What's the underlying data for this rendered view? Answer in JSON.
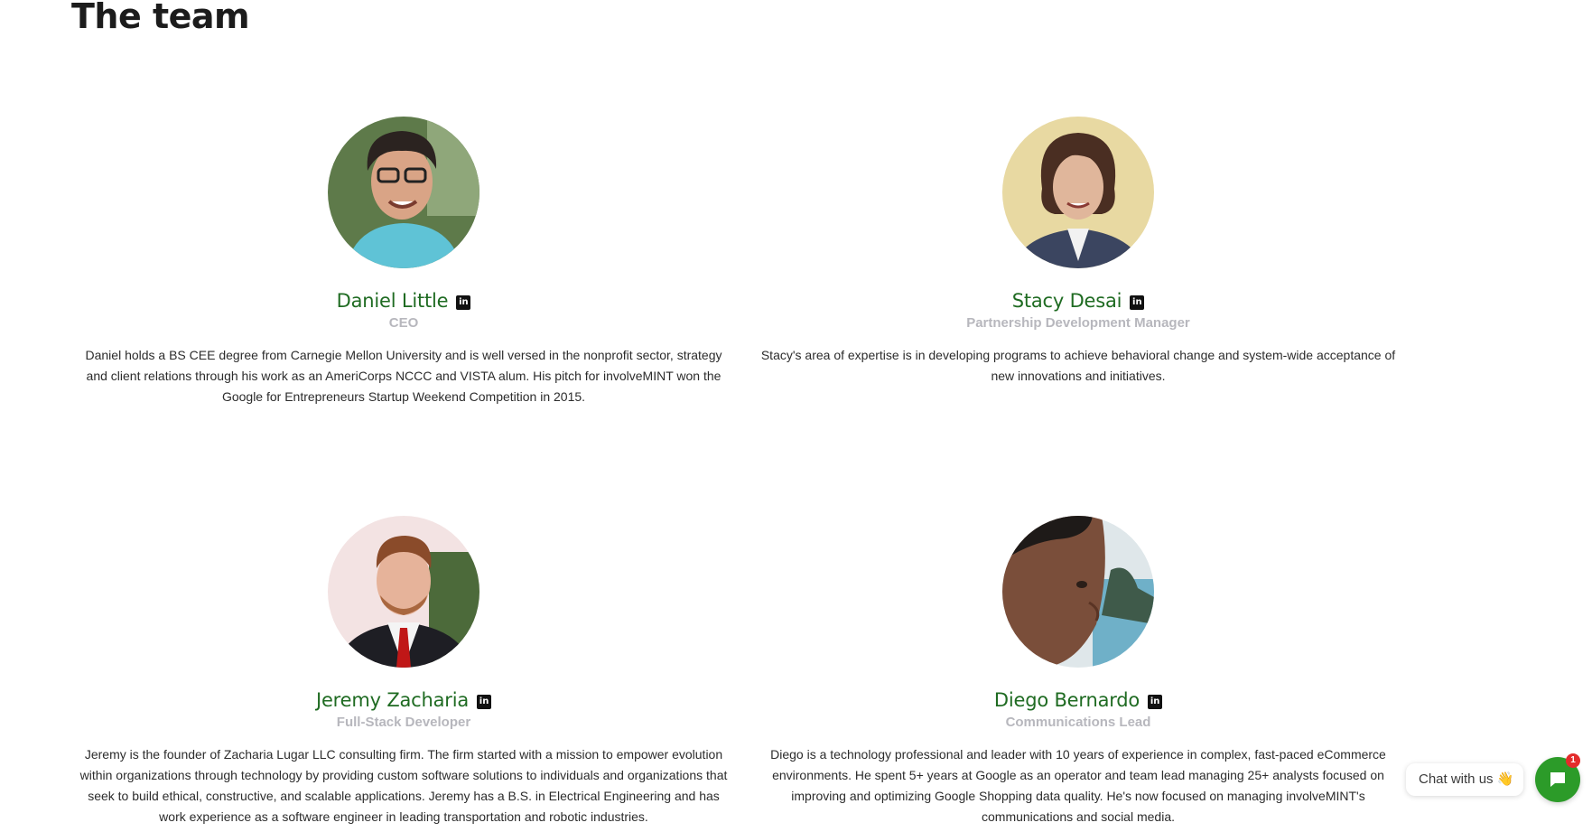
{
  "section": {
    "title": "The team"
  },
  "members": [
    {
      "name": "Daniel Little",
      "role": "CEO",
      "bio": "Daniel holds a BS CEE degree from Carnegie Mellon University and is well versed in the nonprofit sector, strategy and client relations through his work as an AmeriCorps NCCC and VISTA alum. His pitch for involveMINT won the Google for Entrepreneurs Startup Weekend Competition in 2015.",
      "linkedin_icon": "linkedin-icon"
    },
    {
      "name": "Stacy Desai",
      "role": "Partnership Development Manager",
      "bio": "Stacy's area of expertise is in developing programs to achieve behavioral change and system-wide acceptance of new innovations and initiatives.",
      "linkedin_icon": "linkedin-icon"
    },
    {
      "name": "Jeremy Zacharia",
      "role": "Full-Stack Developer",
      "bio": "Jeremy is the founder of Zacharia Lugar LLC consulting firm. The firm started with a mission to empower evolution within organizations through technology by providing custom software solutions to individuals and organizations that seek to build ethical, constructive, and scalable applications. Jeremy has a B.S. in Electrical Engineering and has work experience as a software engineer in leading transportation and robotic industries.",
      "linkedin_icon": "linkedin-icon"
    },
    {
      "name": "Diego Bernardo",
      "role": "Communications Lead",
      "bio": "Diego is a technology professional and leader with 10 years of experience in complex, fast-paced eCommerce environments. He spent 5+ years at Google as an operator and team lead managing 25+ analysts focused on improving and optimizing Google Shopping data quality. He's now focused on managing involveMINT's communications and social media.",
      "linkedin_icon": "linkedin-icon"
    }
  ],
  "chat": {
    "label": "Chat with us 👋",
    "badge": "1",
    "icon": "chat-bubble-icon"
  },
  "colors": {
    "name": "#1f6b22",
    "role": "#b7b7bd",
    "chat_button": "#2c9b29",
    "badge": "#e32b2b"
  }
}
